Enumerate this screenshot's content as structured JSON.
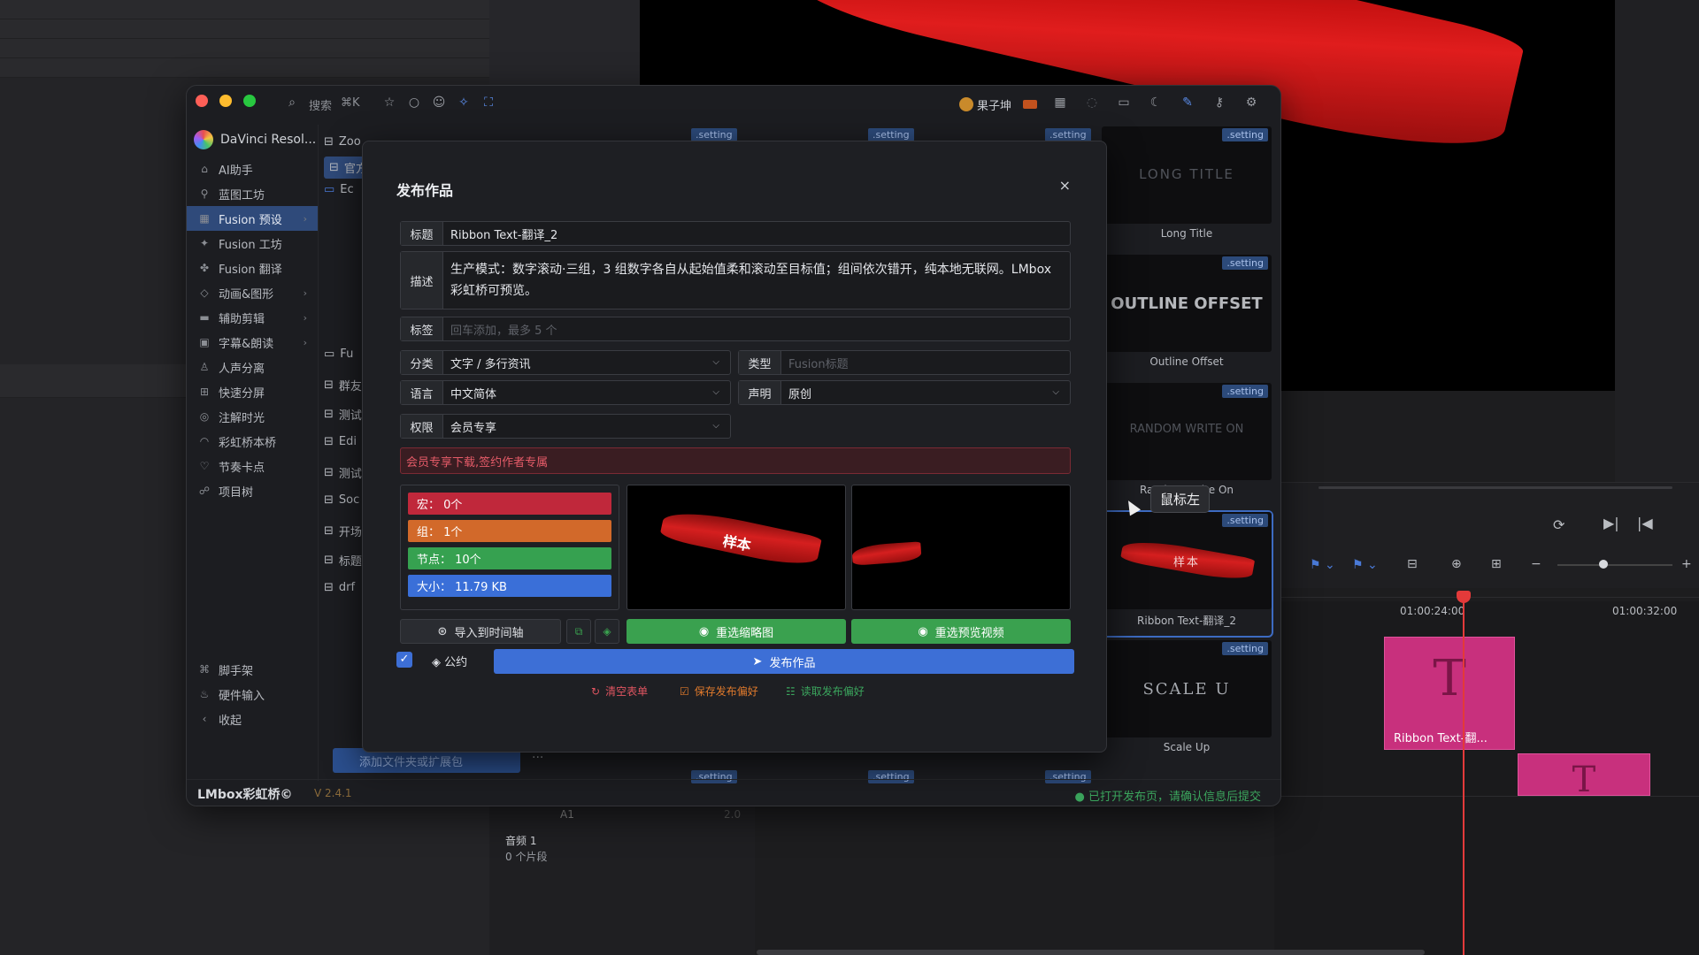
{
  "app": {
    "source_name": "DaVinci Resol...",
    "brand": "LMbox彩虹桥©",
    "version": "V 2.4.1",
    "status_message": "已打开发布页，请确认信息后提交"
  },
  "titlebar": {
    "search_label": "搜索",
    "search_shortcut": "⌘K",
    "user_name": "果子坤",
    "icons": [
      "search-icon",
      "star-icon",
      "circle-icon",
      "user-icon",
      "bridge-icon",
      "frame-icon",
      "calendar-icon",
      "bulb-icon",
      "chat-icon",
      "moon-icon",
      "pin-icon",
      "key-icon",
      "gear-icon"
    ]
  },
  "sidebar": {
    "items": [
      {
        "label": "AI助手",
        "icon": "ai-icon"
      },
      {
        "label": "蓝图工坊",
        "icon": "blueprint-icon"
      },
      {
        "label": "Fusion 预设",
        "icon": "grid-icon",
        "active": true
      },
      {
        "label": "Fusion 工坊",
        "icon": "wrench-icon"
      },
      {
        "label": "Fusion 翻译",
        "icon": "translate-icon"
      },
      {
        "label": "动画&图形",
        "icon": "shape-icon"
      },
      {
        "label": "辅助剪辑",
        "icon": "clip-icon"
      },
      {
        "label": "字幕&朗读",
        "icon": "subtitle-icon"
      },
      {
        "label": "人声分离",
        "icon": "voice-icon"
      },
      {
        "label": "快速分屏",
        "icon": "split-icon"
      },
      {
        "label": "注解时光",
        "icon": "note-icon"
      },
      {
        "label": "彩虹桥本桥",
        "icon": "rainbow-icon"
      },
      {
        "label": "节奏卡点",
        "icon": "beat-icon"
      },
      {
        "label": "项目树",
        "icon": "tree-icon"
      }
    ],
    "bottom_items": [
      {
        "label": "脚手架",
        "icon": "scaffold-icon"
      },
      {
        "label": "硬件输入",
        "icon": "hardware-icon"
      },
      {
        "label": "收起",
        "icon": "collapse-icon"
      }
    ]
  },
  "folders": {
    "items": [
      "Zoo",
      "官方",
      "Ec",
      "Fu",
      "群友",
      "测试",
      "Edi",
      "测试",
      "Soc",
      "开场",
      "标题",
      "drf"
    ],
    "add_button": "添加文件夹或扩展包",
    "more": "···"
  },
  "thumbnails": {
    "tag": ".setting",
    "items": [
      {
        "caption": "Long Title",
        "art": "LONG TITLE"
      },
      {
        "caption": "Outline Offset",
        "art": "OUTLINE OFFSET"
      },
      {
        "caption": "Random Write On",
        "art": "RANDOM WRITE ON"
      },
      {
        "caption": "Ribbon Text-翻译_2",
        "art": "样本"
      },
      {
        "caption": "Scale Up",
        "art": "SCALE U"
      }
    ]
  },
  "modal": {
    "title": "发布作品",
    "close": "×",
    "fields": {
      "title": {
        "label": "标题",
        "value": "Ribbon Text-翻译_2"
      },
      "description": {
        "label": "描述",
        "value": "生产模式：数字滚动·三组，3 组数字各自从起始值柔和滚动至目标值；组间依次错开，纯本地无联网。LMbox 彩虹桥可预览。"
      },
      "tags": {
        "label": "标签",
        "placeholder": "回车添加，最多 5 个"
      },
      "category": {
        "label": "分类",
        "value": "文字 / 多行资讯"
      },
      "type": {
        "label": "类型",
        "placeholder": "Fusion标题"
      },
      "language": {
        "label": "语言",
        "value": "中文简体"
      },
      "statement": {
        "label": "声明",
        "value": "原创"
      },
      "permission": {
        "label": "权限",
        "value": "会员专享"
      }
    },
    "warning": "会员专享下载,签约作者专属",
    "stats": [
      {
        "label": "宏： 0个",
        "color": "#c0283b"
      },
      {
        "label": "组： 1个",
        "color": "#d2692a"
      },
      {
        "label": "节点： 10个",
        "color": "#36a150"
      },
      {
        "label": "大小： 11.79 KB",
        "color": "#3a6fd8"
      }
    ],
    "preview_sample_text": "样本",
    "buttons": {
      "import": "导入到时间轴",
      "reselect_thumb": "重选缩略图",
      "reselect_video": "重选预览视频",
      "publish": "发布作品"
    },
    "pledge": "公约",
    "pledge_checked": true,
    "links": {
      "clear": "清空表单",
      "save_pref": "保存发布偏好",
      "load_pref": "读取发布偏好"
    }
  },
  "davinci": {
    "timecode_1": "01:00:24:00",
    "timecode_2": "01:00:32:00",
    "clip_label": "Ribbon Text-翻...",
    "clip_glyph": "T",
    "audio_track": "音频 1",
    "audio_clips": "0 个片段",
    "track_a1": "A1",
    "track_value": "2.0"
  },
  "tooltip": "鼠标左"
}
